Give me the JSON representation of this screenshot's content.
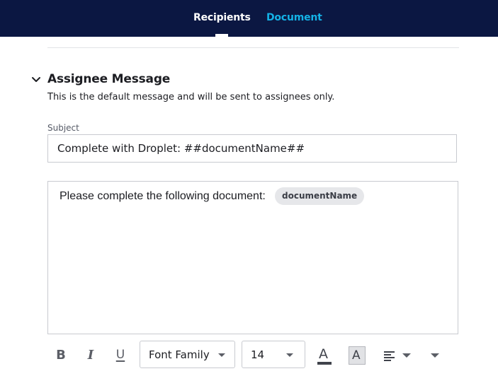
{
  "header": {
    "tabs": [
      {
        "label": "Recipients",
        "active": true
      },
      {
        "label": "Document",
        "active": false
      }
    ]
  },
  "assignee_message": {
    "title": "Assignee Message",
    "description": "This is the default message and will be sent to assignees only.",
    "expanded": true,
    "subject": {
      "label": "Subject",
      "value": "Complete with Droplet: ##documentName##"
    },
    "body": {
      "text": "Please complete the following document:",
      "placeholder_token": "documentName"
    }
  },
  "toolbar": {
    "bold": "B",
    "italic": "I",
    "underline": "U",
    "font_family": "Font Family",
    "font_size": "14",
    "text_color_glyph": "A",
    "background_color_glyph": "A",
    "align_icon": "align-left-icon",
    "more_icon": "chevron-down-icon"
  },
  "colors": {
    "header_bg": "#0b1742",
    "active_tab": "#ffffff",
    "inactive_tab": "#14b2e6",
    "chip_bg": "#e6e7ea"
  }
}
